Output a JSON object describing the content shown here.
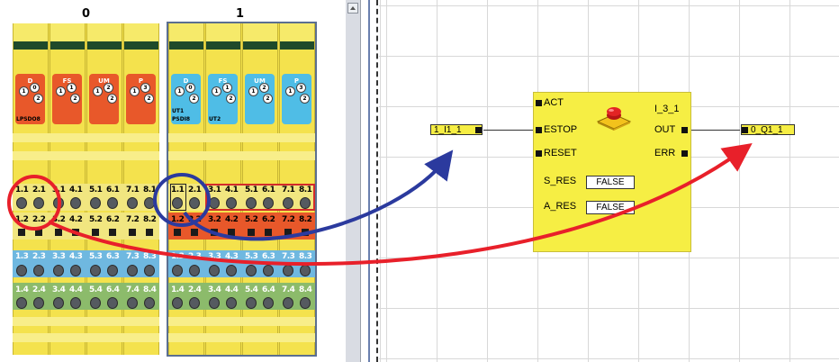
{
  "units": [
    {
      "label": "0"
    },
    {
      "label": "1"
    }
  ],
  "unit0": {
    "chips": [
      {
        "letter": "D",
        "n1": "1",
        "n2": "0",
        "n3": "2"
      },
      {
        "letter": "FS",
        "n1": "1",
        "n2": "1",
        "n3": "2"
      },
      {
        "letter": "UM",
        "n1": "1",
        "n2": "2",
        "n3": "2"
      },
      {
        "letter": "P",
        "n1": "1",
        "n2": "3",
        "n3": "2"
      }
    ],
    "chip_sub": "LPSDO8",
    "row1": [
      "1.1",
      "2.1",
      "3.1",
      "4.1",
      "5.1",
      "6.1",
      "7.1",
      "8.1"
    ],
    "row2": [
      "1.2",
      "2.2",
      "3.2",
      "4.2",
      "5.2",
      "6.2",
      "7.2",
      "8.2"
    ],
    "row3": [
      "1.3",
      "2.3",
      "3.3",
      "4.3",
      "5.3",
      "6.3",
      "7.3",
      "8.3"
    ],
    "row4": [
      "1.4",
      "2.4",
      "3.4",
      "4.4",
      "5.4",
      "6.4",
      "7.4",
      "8.4"
    ]
  },
  "unit1": {
    "chips": [
      {
        "letter": "D",
        "n1": "1",
        "n2": "0",
        "n3": "2"
      },
      {
        "letter": "FS",
        "n1": "1",
        "n2": "1",
        "n3": "2"
      },
      {
        "letter": "UM",
        "n1": "1",
        "n2": "2",
        "n3": "2"
      },
      {
        "letter": "P",
        "n1": "1",
        "n2": "3",
        "n3": "2"
      }
    ],
    "chip_sub_a": "UT1",
    "chip_sub_b": "PSDI8",
    "chip_sub_c": "UT2",
    "row1": [
      "1.1",
      "2.1",
      "3.1",
      "4.1",
      "5.1",
      "6.1",
      "7.1",
      "8.1"
    ],
    "row2": [
      "1.2",
      "2.2",
      "3.2",
      "4.2",
      "5.2",
      "6.2",
      "7.2",
      "8.2"
    ],
    "row3": [
      "1.3",
      "2.3",
      "3.3",
      "4.3",
      "5.3",
      "6.3",
      "7.3",
      "8.3"
    ],
    "row4": [
      "1.4",
      "2.4",
      "3.4",
      "4.4",
      "5.4",
      "6.4",
      "7.4",
      "8.4"
    ]
  },
  "block": {
    "name": "I_3_1",
    "inputs": [
      "ACT",
      "ESTOP",
      "RESET"
    ],
    "outputs": [
      "OUT",
      "ERR"
    ],
    "params": [
      {
        "label": "S_RES",
        "value": "FALSE"
      },
      {
        "label": "A_RES",
        "value": "FALSE"
      }
    ]
  },
  "input_var": "1_I1_1",
  "output_var": "0_Q1_1",
  "colors": {
    "module_yellow": "#f4e24d",
    "chip_orange": "#e8582a",
    "chip_blue": "#4fbde6",
    "term_red": "#e8582a",
    "term_blue": "#6fb8e0",
    "term_green": "#8cbb6b",
    "block_yellow": "#f6ee44",
    "arrow_blue": "#2b3a9e",
    "arrow_red": "#e8202a"
  }
}
